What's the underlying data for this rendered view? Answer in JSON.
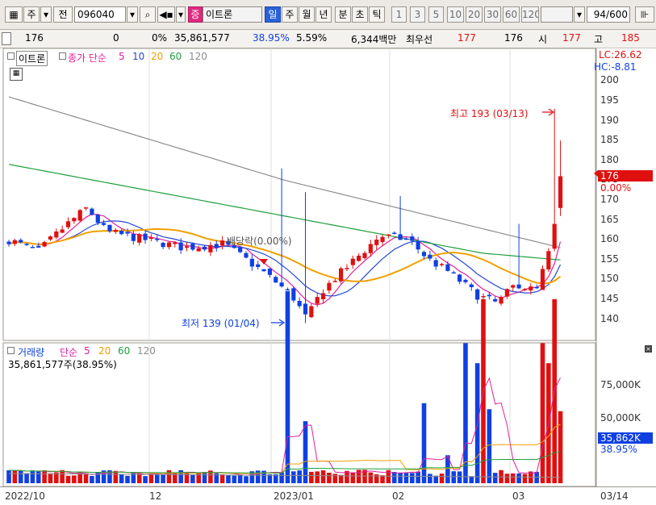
{
  "toolbar": {
    "market_label": "주",
    "prev_label": "전",
    "stock_code": "096040",
    "type_badge": "증",
    "stock_name": "이트론",
    "period_day": "일",
    "period_week": "주",
    "period_month": "월",
    "period_year": "년",
    "period_minute": "분",
    "period_second": "초",
    "period_tick": "틱",
    "intervals": [
      "1",
      "3",
      "5",
      "10",
      "20",
      "30",
      "60",
      "120"
    ],
    "count_value": "94",
    "count_total": "/600",
    "period_day_color": "#2a62d8"
  },
  "infobar": {
    "price": "176",
    "change": "0",
    "change_pct": "0%",
    "volume": "35,861,577",
    "turnover": "38.95%",
    "pct2": "5.59%",
    "amount": "6,344백만",
    "best_label": "최우선",
    "best_ask": "177",
    "best_bid": "176",
    "open_label": "시",
    "open": "177",
    "high_label": "고",
    "high": "185"
  },
  "price_pane": {
    "name_tag": "이트론",
    "ma_legend_label": "종가 단순",
    "ma_periods": [
      "5",
      "10",
      "20",
      "60",
      "120"
    ],
    "ma_colors": [
      "#e0209a",
      "#2848d0",
      "#f0a000",
      "#20a040",
      "#8c8c8c"
    ],
    "lc": "LC:26.62",
    "hc": "HC:-8.81",
    "current_price": "176",
    "current_change": "0.00%",
    "high_annotation": "최고 193 (03/13)",
    "low_annotation": "최저 139 (01/04)",
    "dividend_annotation": "배당락(0.00%)",
    "up_color": "#e01010",
    "down_color": "#1040e0"
  },
  "volume_pane": {
    "title": "거래량",
    "ma_legend_label": "단순",
    "ma_periods": [
      "5",
      "20",
      "60",
      "120"
    ],
    "current_volume_text": "35,861,577주(38.95%)",
    "current_volume_badge": "35,862K",
    "current_pct_badge": "38.95%"
  },
  "chart_data": [
    {
      "type": "candlestick",
      "y_ticks": [
        200,
        195,
        190,
        185,
        180,
        175,
        170,
        165,
        160,
        155,
        150,
        145,
        140
      ],
      "ylim": [
        136,
        204
      ],
      "high": 193,
      "high_date": "03/13",
      "low": 139,
      "low_date": "01/04",
      "last_close": 176
    },
    {
      "type": "bar",
      "y_ticks": [
        "75,000K",
        "50,000K"
      ],
      "last_volume": "35,862K"
    }
  ],
  "x_axis": {
    "labels": [
      "2022/10",
      "12",
      "2023/01",
      "02",
      "03",
      "03/14"
    ]
  }
}
